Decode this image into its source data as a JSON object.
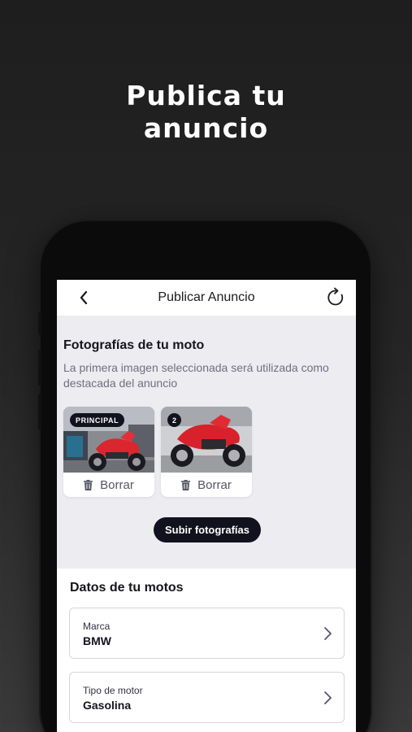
{
  "hero": {
    "line1": "Publica tu",
    "line2": "anuncio"
  },
  "appbar": {
    "title": "Publicar Anuncio",
    "back_icon": "chevron-left-icon",
    "refresh_icon": "refresh-icon"
  },
  "photos": {
    "title": "Fotografías de tu moto",
    "description": "La primera imagen seleccionada será utilizada como destacada del anuncio",
    "items": [
      {
        "badge": "PRINCIPAL",
        "delete_label": "Borrar"
      },
      {
        "badge": "2",
        "delete_label": "Borrar"
      }
    ],
    "upload_label": "Subir fotografías"
  },
  "datos": {
    "title": "Datos de tu motos",
    "fields": [
      {
        "label": "Marca",
        "value": "BMW"
      },
      {
        "label": "Tipo de motor",
        "value": "Gasolina"
      }
    ]
  },
  "colors": {
    "accent_dark": "#12121e",
    "background": "#1e1e1e",
    "screen_bg": "#ececf1"
  }
}
